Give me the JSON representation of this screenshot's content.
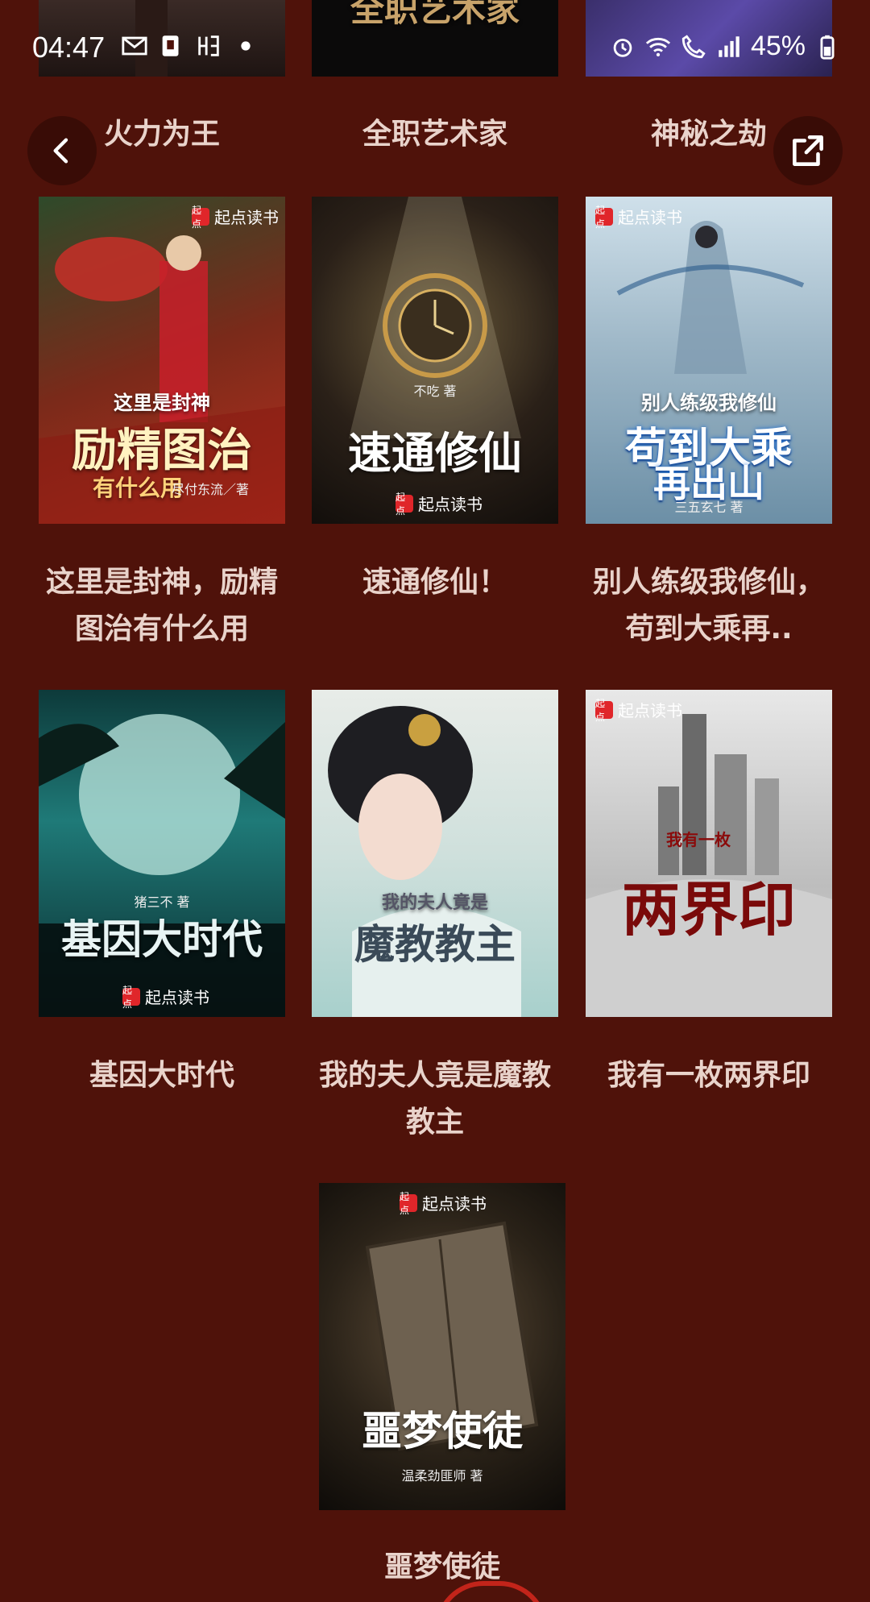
{
  "status": {
    "time": "04:47",
    "battery": "45%"
  },
  "nav": {
    "back_icon": "chevron-left-icon",
    "share_icon": "external-link-icon"
  },
  "cover_publisher": "起点读书",
  "cover_publisher_mark": "起点",
  "top_row": [
    {
      "title": "火力为王"
    },
    {
      "title": "全职艺术家",
      "cover_title": "全职艺术家"
    },
    {
      "title": "神秘之劫"
    }
  ],
  "books": [
    {
      "title": "这里是封神，励精图治有什么用",
      "cover_title": "励精图治",
      "cover_subtitle": "这里是封神",
      "cover_sub2": "有什么用",
      "cover_author": "尽付东流／著"
    },
    {
      "title": "速通修仙！",
      "cover_title": "速通修仙",
      "cover_author": "不吃 著"
    },
    {
      "title": "别人练级我修仙，苟到大乘再..",
      "cover_title": "苟到大乘",
      "cover_subtitle": "别人练级我修仙",
      "cover_sub2": "再出山",
      "cover_author": "三五玄七 著"
    },
    {
      "title": "基因大时代",
      "cover_title": "基因大时代",
      "cover_author": "猪三不 著"
    },
    {
      "title": "我的夫人竟是魔教教主",
      "cover_title": "魔教教主",
      "cover_subtitle": "我的夫人竟是"
    },
    {
      "title": "我有一枚两界印",
      "cover_title": "两界印",
      "cover_subtitle": "我有一枚"
    },
    {
      "title": "噩梦使徒",
      "cover_title": "噩梦使徒",
      "cover_author": "温柔劲匪师 著"
    }
  ],
  "colors": {
    "background": "#4f120a",
    "title_text": "#e9d3cb",
    "brand_red": "#e0262a"
  }
}
